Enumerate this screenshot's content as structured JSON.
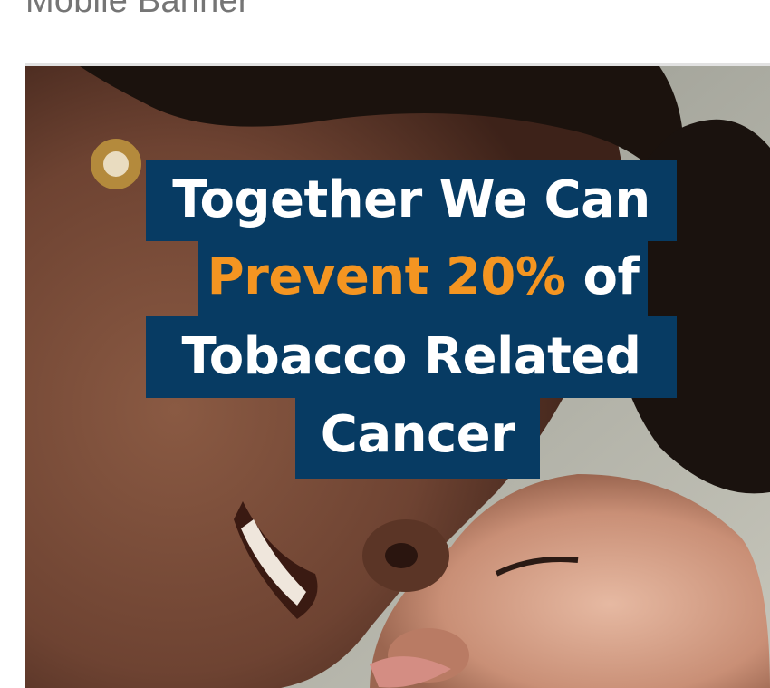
{
  "page": {
    "heading": "Mobile Banner"
  },
  "banner": {
    "headline": {
      "line1": "Together We Can",
      "line2_highlight": "Prevent 20%",
      "line2_rest": " of",
      "line3": "Tobacco Related",
      "line4": "Cancer"
    },
    "colors": {
      "box_background": "#073b63",
      "text": "#ffffff",
      "highlight": "#f49521"
    }
  }
}
